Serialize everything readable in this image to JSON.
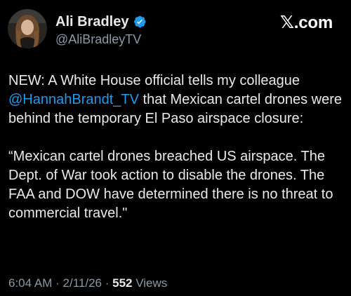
{
  "author": {
    "name": "Ali Bradley",
    "handle": "@AliBradleyTV",
    "verified": true,
    "verified_color": "#1d9bf0"
  },
  "brand": {
    "logo_text": "com",
    "logo_glyph": "𝕏",
    "logo_dot": "."
  },
  "tweet": {
    "line1": "NEW: A White House official tells my colleague",
    "mention": "@HannahBrandt_TV",
    "line2_rest": " that Mexican cartel drones were behind the temporary El Paso airspace closure:",
    "quote": "“Mexican cartel drones breached US airspace. The Dept. of War took action to disable the drones. The FAA and DOW have determined there is no threat to commercial travel.\"",
    "mention_color": "#1d9bf0"
  },
  "meta": {
    "time": "6:04 AM",
    "separator": "·",
    "date": "2/11/26",
    "views_count": "552",
    "views_label": "Views"
  },
  "icons": {
    "verified": "verified-badge-icon",
    "logo": "x-logo-icon"
  }
}
